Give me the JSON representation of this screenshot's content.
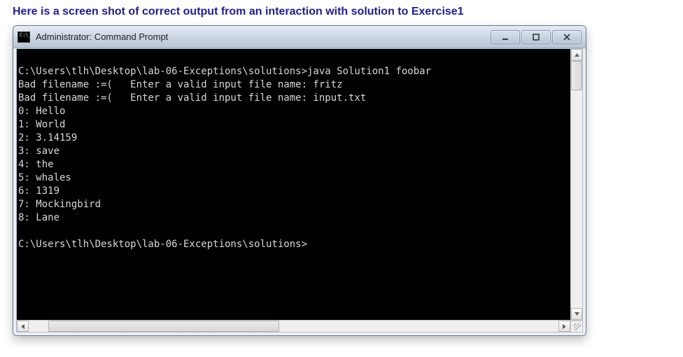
{
  "caption": "Here is a screen shot of correct output from an interaction with solution to Exercise1",
  "window": {
    "title": "Administrator: Command Prompt",
    "controls": {
      "minimize": "minimize",
      "maximize": "maximize",
      "close": "close"
    }
  },
  "terminal": {
    "prompt_path": "C:\\Users\\tlh\\Desktop\\lab-06-Exceptions\\solutions>",
    "command": "java Solution1 foobar",
    "bad_prefix": "Bad filename :=(   Enter a valid input file name: ",
    "bad_inputs": [
      "fritz",
      "input.txt"
    ],
    "output_lines": [
      "0: Hello",
      "1: World",
      "2: 3.14159",
      "3: save",
      "4: the",
      "5: whales",
      "6: 1319",
      "7: Mockingbird",
      "8: Lane"
    ],
    "final_prompt": "C:\\Users\\tlh\\Desktop\\lab-06-Exceptions\\solutions>"
  }
}
